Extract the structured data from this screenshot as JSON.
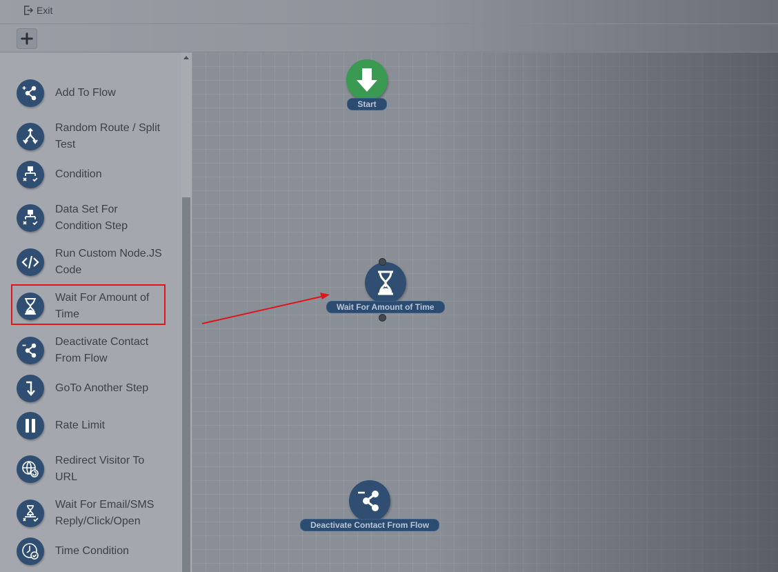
{
  "header": {
    "exit_label": "Exit",
    "add_icon": "plus-icon",
    "exit_icon": "exit-icon"
  },
  "sidebar": {
    "items": [
      {
        "label": "Add To Flow",
        "icon": "add-to-flow-icon"
      },
      {
        "label": "Random Route / Split Test",
        "icon": "split-icon"
      },
      {
        "label": "Condition",
        "icon": "condition-icon"
      },
      {
        "label": "Data Set For Condition Step",
        "icon": "condition-icon"
      },
      {
        "label": "Run Custom Node.JS Code",
        "icon": "code-icon"
      },
      {
        "label": "Wait For Amount of Time",
        "icon": "hourglass-icon"
      },
      {
        "label": "Deactivate Contact From Flow",
        "icon": "deactivate-icon"
      },
      {
        "label": "GoTo Another Step",
        "icon": "goto-icon"
      },
      {
        "label": "Rate Limit",
        "icon": "pause-icon"
      },
      {
        "label": "Redirect Visitor To URL",
        "icon": "globe-icon"
      },
      {
        "label": "Wait For Email/SMS Reply/Click/Open",
        "icon": "hourglass-branch-icon"
      },
      {
        "label": "Time Condition",
        "icon": "clock-icon"
      }
    ],
    "highlighted_item": "Wait For Amount of Time"
  },
  "canvas": {
    "nodes": [
      {
        "label": "Start",
        "icon": "down-arrow-icon",
        "color": "#3a9a52"
      },
      {
        "label": "Wait For Amount of Time",
        "icon": "hourglass-icon",
        "color": "#2f4e72"
      },
      {
        "label": "Deactivate Contact From Flow",
        "icon": "deactivate-icon",
        "color": "#2f4e72"
      }
    ]
  },
  "colors": {
    "node_blue": "#2f4e72",
    "start_green": "#3a9a52",
    "highlight_red": "#e0141a"
  }
}
